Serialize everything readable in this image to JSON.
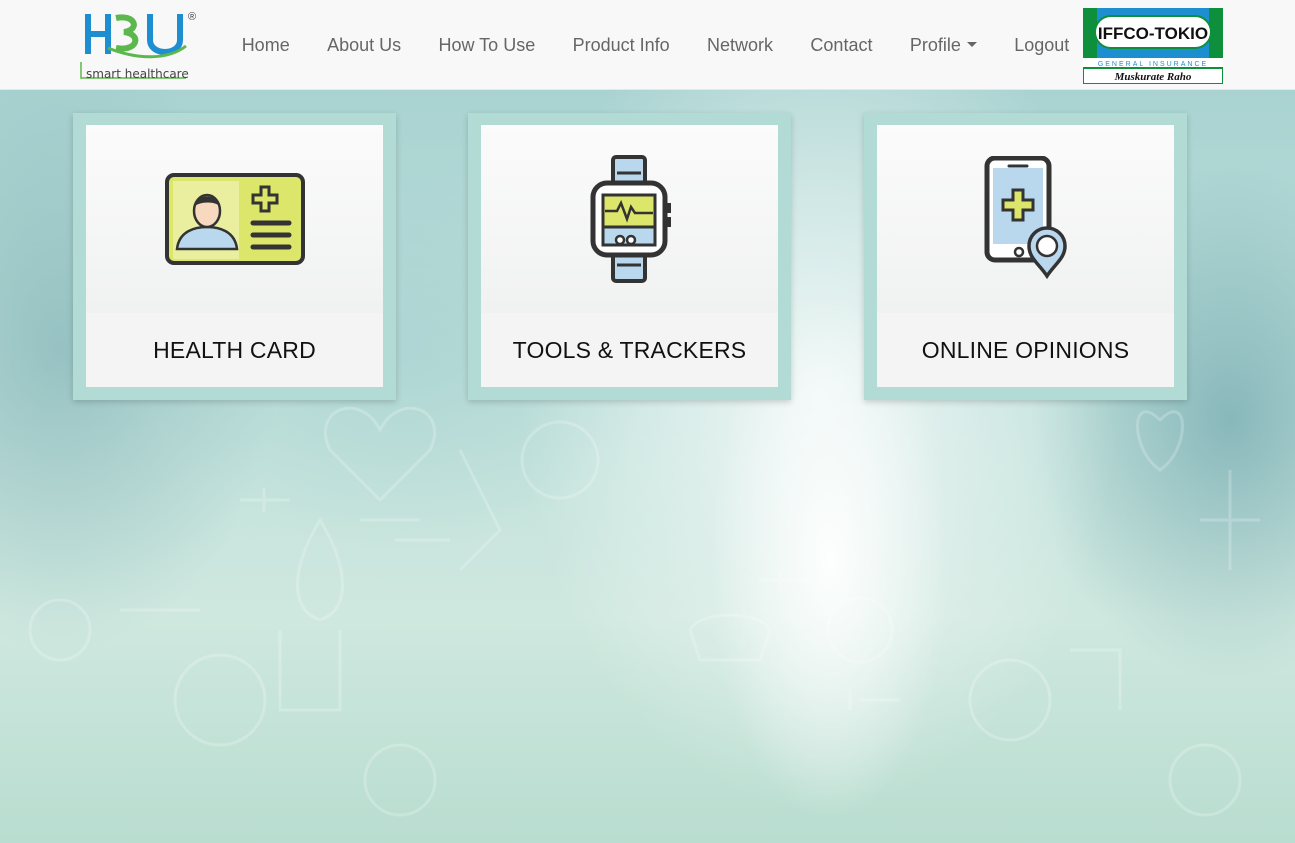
{
  "brand": {
    "logo_text": "HBU",
    "logo_tagline": "smart healthcare",
    "registered_mark": "®"
  },
  "nav": {
    "items": [
      {
        "label": "Home"
      },
      {
        "label": "About Us"
      },
      {
        "label": "How To Use"
      },
      {
        "label": "Product Info"
      },
      {
        "label": "Network"
      },
      {
        "label": "Contact"
      },
      {
        "label": "Profile",
        "has_dropdown": true
      },
      {
        "label": "Logout"
      }
    ]
  },
  "partner": {
    "name": "IFFCO-TOKIO",
    "subtitle": "GENERAL INSURANCE",
    "tagline": "Muskurate Raho"
  },
  "cards": [
    {
      "label": "HEALTH CARD",
      "icon": "health-card-icon"
    },
    {
      "label": "TOOLS & TRACKERS",
      "icon": "smartwatch-icon"
    },
    {
      "label": "ONLINE OPINIONS",
      "icon": "mobile-location-icon"
    }
  ],
  "colors": {
    "navbar_bg": "#f8f8f8",
    "nav_text": "#666666",
    "card_frame": "#b2dbd6",
    "icon_fill": "#dce66a",
    "icon_stroke": "#333333",
    "logo_blue": "#1d8fd1",
    "logo_green": "#5cb84c",
    "partner_green": "#0e8f3c",
    "partner_blue": "#1d8fd1"
  }
}
